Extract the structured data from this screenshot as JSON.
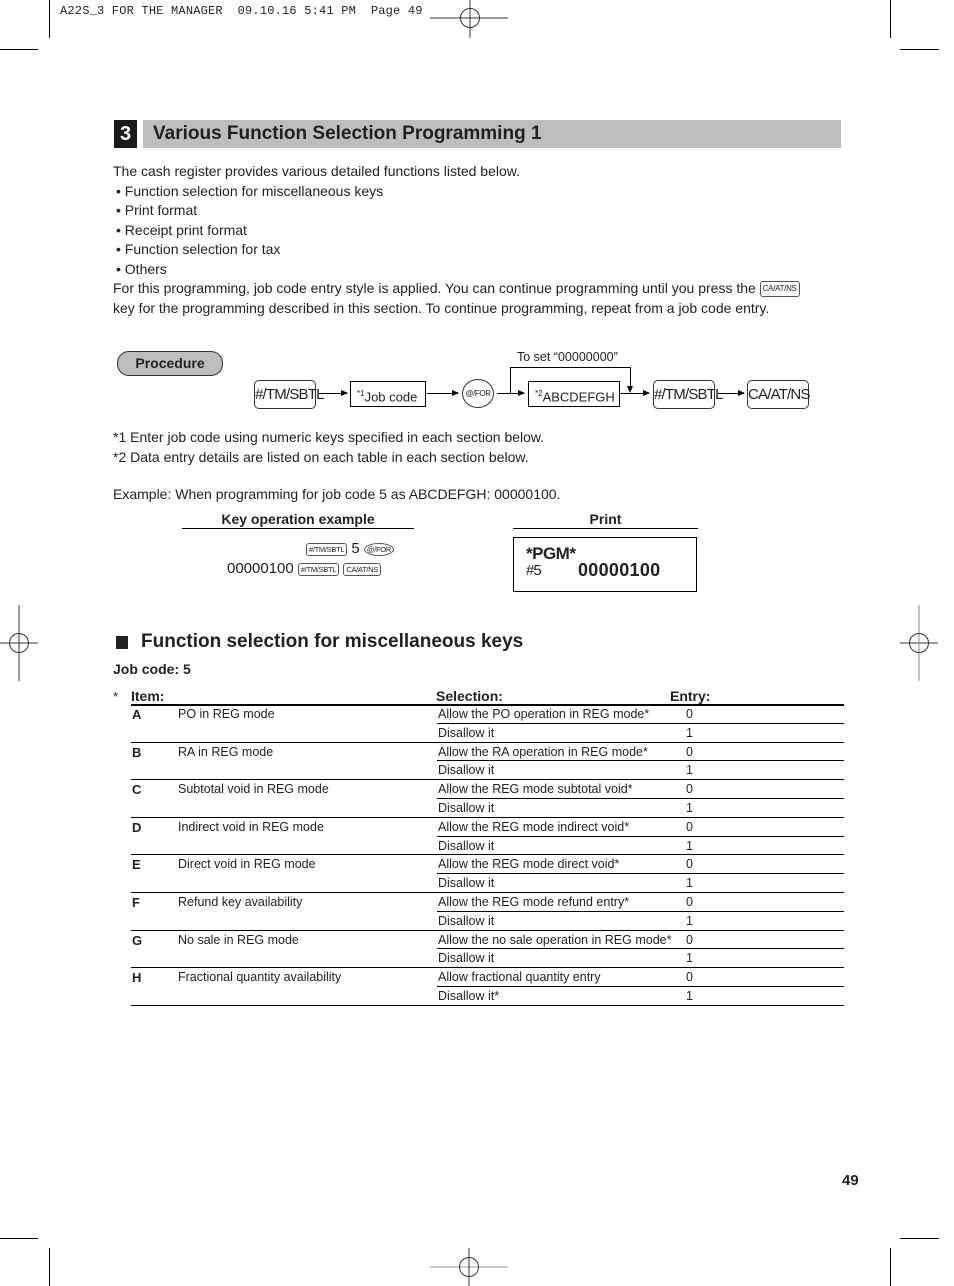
{
  "slug": "A22S_3 FOR THE MANAGER  09.10.16 5:41 PM  Page 49",
  "section": {
    "number": "3",
    "title": "Various Function Selection Programming 1"
  },
  "intro": {
    "lead": "The cash register provides various detailed functions listed below.",
    "bullets": [
      "• Function selection for miscellaneous keys",
      "• Print format",
      "• Receipt print format",
      "• Function selection for tax",
      "• Others"
    ],
    "para_part1": "For this programming, job code entry style is applied.  You can continue programming until you press the",
    "para_key": "CA/AT/NS",
    "para_part2": "key for the programming described in this section.  To continue programming, repeat from a job code entry."
  },
  "procedure": {
    "label": "Procedure",
    "key_subtotal": "#/TM/SBTL",
    "job_code_mark": "*1",
    "job_code_label": "Job code",
    "key_for": "@/FOR",
    "data_mark": "*2",
    "data_label": "ABCDEFGH",
    "bypass_label": "To set “00000000”",
    "key_subtotal_2": "#/TM/SBTL",
    "key_cash": "CA/AT/NS"
  },
  "notes": [
    "*1  Enter job code using numeric keys specified in each section below.",
    "*2  Data entry details are listed on each table in each section below."
  ],
  "example": "Example:  When programming for job code 5 as ABCDEFGH: 00000100.",
  "key_operation": {
    "heading": "Key operation example",
    "line1_key1": "#/TM/SBTL",
    "line1_digit": "5",
    "line1_key2": "@/FOR",
    "line2_value": "00000100",
    "line2_key1": "#/TM/SBTL",
    "line2_key2": "CA/AT/NS"
  },
  "print": {
    "heading": "Print",
    "line1": "*PGM*",
    "line2_code": "#5",
    "line2_value": "00000100"
  },
  "subsection": {
    "title": "Function selection for miscellaneous keys",
    "job_code": "Job code:  5"
  },
  "table": {
    "star": "*",
    "headers": {
      "item": "Item:",
      "selection": "Selection:",
      "entry": "Entry:"
    },
    "rows": [
      {
        "letter": "A",
        "item": "PO in REG mode",
        "options": [
          {
            "selection": "Allow the PO operation in REG mode*",
            "entry": "0"
          },
          {
            "selection": "Disallow it",
            "entry": "1"
          }
        ]
      },
      {
        "letter": "B",
        "item": "RA in REG mode",
        "options": [
          {
            "selection": "Allow the RA operation in REG mode*",
            "entry": "0"
          },
          {
            "selection": "Disallow it",
            "entry": "1"
          }
        ]
      },
      {
        "letter": "C",
        "item": "Subtotal void in REG mode",
        "options": [
          {
            "selection": "Allow the REG mode subtotal void*",
            "entry": "0"
          },
          {
            "selection": "Disallow it",
            "entry": "1"
          }
        ]
      },
      {
        "letter": "D",
        "item": "Indirect void in REG mode",
        "options": [
          {
            "selection": "Allow the REG mode indirect void*",
            "entry": "0"
          },
          {
            "selection": "Disallow it",
            "entry": "1"
          }
        ]
      },
      {
        "letter": "E",
        "item": "Direct void in REG mode",
        "options": [
          {
            "selection": "Allow the REG mode direct void*",
            "entry": "0"
          },
          {
            "selection": "Disallow it",
            "entry": "1"
          }
        ]
      },
      {
        "letter": "F",
        "item": "Refund key availability",
        "options": [
          {
            "selection": "Allow the REG mode refund entry*",
            "entry": "0"
          },
          {
            "selection": "Disallow it",
            "entry": "1"
          }
        ]
      },
      {
        "letter": "G",
        "item": "No sale in REG mode",
        "options": [
          {
            "selection": "Allow the no sale operation in REG mode*",
            "entry": "0"
          },
          {
            "selection": "Disallow it",
            "entry": "1"
          }
        ]
      },
      {
        "letter": "H",
        "item": "Fractional quantity availability",
        "options": [
          {
            "selection": "Allow fractional quantity entry",
            "entry": "0"
          },
          {
            "selection": "Disallow it*",
            "entry": "1"
          }
        ]
      }
    ]
  },
  "page_number": "49",
  "colors": {
    "title_bar": "#bdbdbd",
    "section_badge": "#1a1a1a",
    "text": "#231f20"
  }
}
